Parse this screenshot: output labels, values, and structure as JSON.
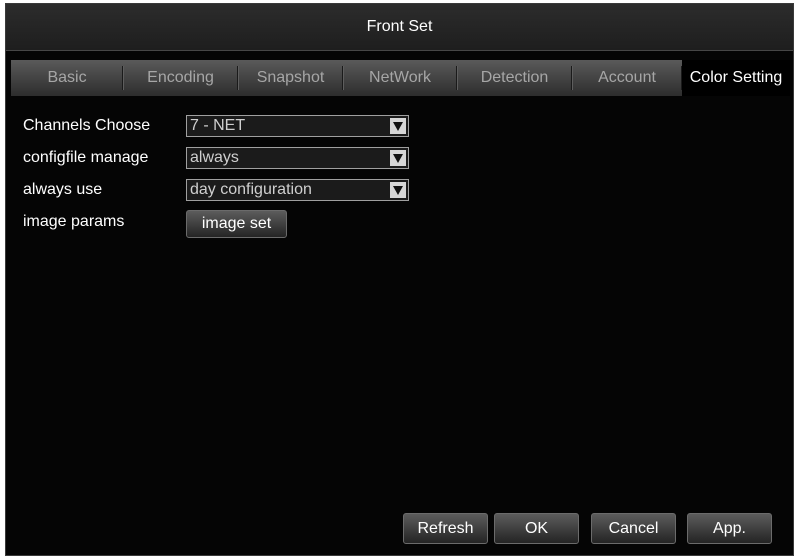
{
  "window": {
    "title": "Front Set"
  },
  "tabs": [
    {
      "label": "Basic"
    },
    {
      "label": "Encoding"
    },
    {
      "label": "Snapshot"
    },
    {
      "label": "NetWork"
    },
    {
      "label": "Detection"
    },
    {
      "label": "Account"
    },
    {
      "label": "Color Setting",
      "active": true
    }
  ],
  "form": {
    "channels_choose": {
      "label": "Channels Choose",
      "value": "7 - NET"
    },
    "configfile_manage": {
      "label": "configfile manage",
      "value": "always"
    },
    "always_use": {
      "label": "always use",
      "value": "day configuration"
    },
    "image_params": {
      "label": "image params",
      "button": "image set"
    }
  },
  "footer": {
    "refresh": "Refresh",
    "ok": "OK",
    "cancel": "Cancel",
    "apply": "App."
  },
  "icons": {
    "dropdown_arrow": "triangle-down-icon"
  },
  "colors": {
    "background": "#050505",
    "text": "#ffffff",
    "inactive_tab": "#a6a6a6"
  }
}
